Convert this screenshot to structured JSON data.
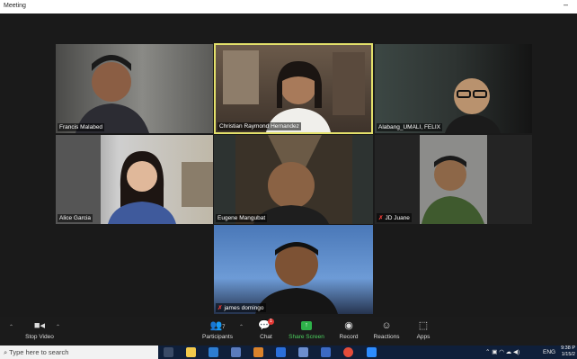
{
  "window": {
    "title": "Meeting",
    "minimize_glyph": "–"
  },
  "participants": [
    {
      "name": "Francis Malabed",
      "muted": false,
      "active": false
    },
    {
      "name": "Christian Raymond Hernandez",
      "muted": false,
      "active": true
    },
    {
      "name": "Alabang_UMALI, FELIX",
      "muted": false,
      "active": false
    },
    {
      "name": "Alice Garcia",
      "muted": false,
      "active": false
    },
    {
      "name": "Eugene Mangubat",
      "muted": false,
      "active": false
    },
    {
      "name": "JD Juane",
      "muted": true,
      "active": false
    },
    {
      "name": "james domingo",
      "muted": true,
      "active": false
    }
  ],
  "controls": {
    "stop_video": "Stop Video",
    "participants": "Participants",
    "participants_count": "7",
    "chat": "Chat",
    "chat_badge": "1",
    "share_screen": "Share Screen",
    "record": "Record",
    "reactions": "Reactions",
    "apps": "Apps",
    "share_color": "#2eb34a"
  },
  "taskbar": {
    "search_placeholder": "Type here to search",
    "language": "ENG",
    "time": "9:38 P",
    "date": "1/15/2"
  }
}
